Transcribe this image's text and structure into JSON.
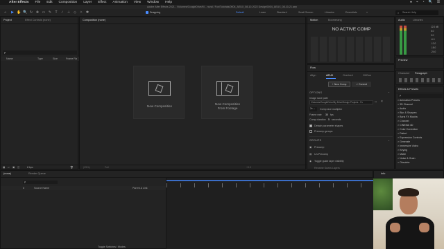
{
  "menubar": {
    "apple_icon": "apple-logo-icon",
    "app_name": "After Effects",
    "items": [
      "File",
      "Edit",
      "Composition",
      "Layer",
      "Effect",
      "Animation",
      "View",
      "Window",
      "Help"
    ],
    "right_status": [
      "●",
      "⌁",
      "◔",
      "🔍",
      "☰"
    ]
  },
  "titlebar": {
    "text": "Adobe After Effects 2021 - /Volumes/GoogleDrive/M... nural / Fun/Tutorials/0004_AEUX_08-10-2022 Design/0004_AEUX_08-10-21.aep"
  },
  "toolbar": {
    "snapping": "Snapping",
    "workspaces": [
      "Default",
      "Learn",
      "Standard",
      "Small Screen",
      "Libraries",
      "Essentials"
    ],
    "active_workspace": "Default",
    "search_help_placeholder": "Search Help"
  },
  "left_panel": {
    "tabs": [
      "Project",
      "Effect Controls (none)"
    ],
    "columns": [
      "Name",
      "Type",
      "Size",
      "Frame Ra"
    ],
    "bottom_label": "8 bpc"
  },
  "composition_panel": {
    "tab": "Composition (none)",
    "cards": [
      {
        "label_lines": [
          "New Composition"
        ],
        "icon": "new-composition-icon"
      },
      {
        "label_lines": [
          "New Composition",
          "From Footage"
        ],
        "icon": "composition-from-footage-icon"
      }
    ],
    "footer_items": [
      "(25%)",
      "Full",
      "+0.0"
    ]
  },
  "motion_panel": {
    "tabs": [
      "Motion",
      "Boomerang"
    ],
    "title": "NO ACTIVE COMP"
  },
  "flow_panel": {
    "tab": "Flow",
    "subtabs": [
      "Align",
      "AEUX",
      "Overlord",
      "GifGun"
    ],
    "buttons": [
      "New Comp",
      "Current"
    ],
    "options_title": "OPTIONS",
    "image_save_label": "Image save path",
    "image_save_path": "/Volumes/GoogleDrive/My Drive/Design Projects - Fu",
    "comp_size_value": "2x",
    "comp_size_label": "Comp size multiplier",
    "frame_rate_label": "Frame rate",
    "frame_rate_value": "30",
    "frame_rate_unit": "fps",
    "comp_duration_label": "Comp duration",
    "comp_duration_value": "5",
    "comp_duration_unit": "seconds",
    "checkboxes": [
      "Detach parameter shapes",
      "Precomp groups"
    ],
    "groups_title": "GROUPS",
    "group_actions": [
      "Precomp",
      "Un-Precomp",
      "Toggle guide layer visibility",
      "Rename Guess Layers"
    ]
  },
  "audio_panel": {
    "tabs": [
      "Audio",
      "Libraries"
    ],
    "db_labels": [
      "12.0 dB",
      "6.0",
      "0.0",
      "-6.0",
      "-12.0",
      "-18.0",
      "-24.0"
    ]
  },
  "preview_panel": {
    "tab": "Preview"
  },
  "character_panel": {
    "tabs": [
      "Character",
      "Paragraph"
    ]
  },
  "effects_panel": {
    "title": "Effects & Presets",
    "search_placeholder": "ρ",
    "items": [
      "> Animation Presets",
      "> 3D Channel",
      "> Audio",
      "> Blur & Sharpen",
      "> Boris FX Mocha",
      "> Channel",
      "> CINEMA 4D",
      "> Color Correction",
      "> Distort",
      "> Expression Controls",
      "> Generate",
      "> Immersive Video",
      "> Keying",
      "> Matte",
      "> Noise & Grain",
      "> Obsolete"
    ]
  },
  "timeline": {
    "tabs": [
      "(none)",
      "Render Queue"
    ],
    "columns": [
      "#",
      "Source Name",
      "Parent & Link"
    ],
    "status": "Toggle Switches / Modes",
    "info_tab": "Info"
  },
  "colors": {
    "accent": "#4a8cff",
    "panel_bg": "#232323",
    "highlight": "#3b6ec7"
  }
}
